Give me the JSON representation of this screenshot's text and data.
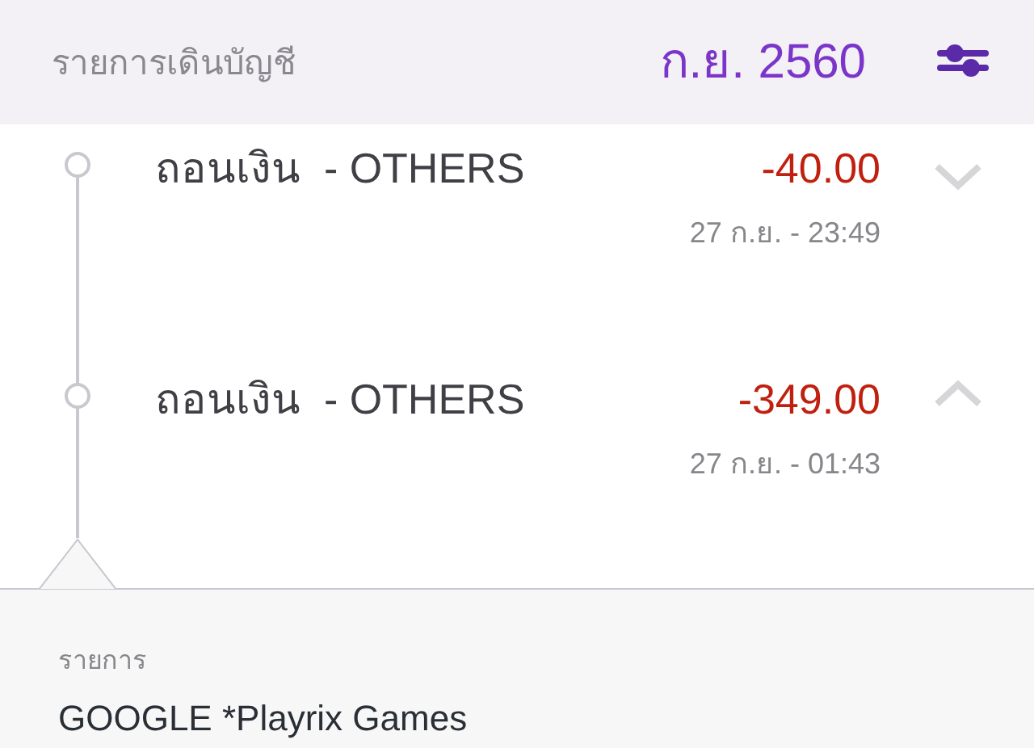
{
  "header": {
    "title": "รายการเดินบัญชี",
    "month": "ก.ย. 2560"
  },
  "transactions": [
    {
      "title": "ถอนเงิน  - OTHERS",
      "amount": "-40.00",
      "datetime": "27 ก.ย. - 23:49",
      "expanded": false
    },
    {
      "title": "ถอนเงิน  - OTHERS",
      "amount": "-349.00",
      "datetime": "27 ก.ย. - 01:43",
      "expanded": true,
      "details": [
        {
          "label": "รายการ",
          "value": "GOOGLE *Playrix Games"
        }
      ]
    }
  ]
}
